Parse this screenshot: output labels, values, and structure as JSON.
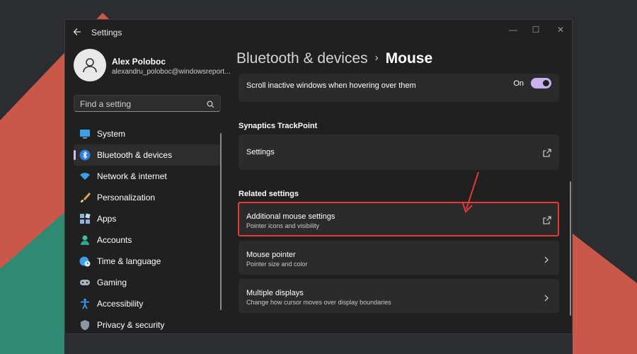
{
  "window": {
    "title": "Settings"
  },
  "account": {
    "name": "Alex Poloboc",
    "email": "alexandru_poloboc@windowsreport..."
  },
  "search": {
    "placeholder": "Find a setting"
  },
  "nav": [
    {
      "label": "System",
      "icon": "monitor-icon"
    },
    {
      "label": "Bluetooth & devices",
      "icon": "bluetooth-icon",
      "active": true
    },
    {
      "label": "Network & internet",
      "icon": "wifi-icon"
    },
    {
      "label": "Personalization",
      "icon": "brush-icon"
    },
    {
      "label": "Apps",
      "icon": "apps-icon"
    },
    {
      "label": "Accounts",
      "icon": "person-icon"
    },
    {
      "label": "Time & language",
      "icon": "globe-clock-icon"
    },
    {
      "label": "Gaming",
      "icon": "gamepad-icon"
    },
    {
      "label": "Accessibility",
      "icon": "accessibility-icon"
    },
    {
      "label": "Privacy & security",
      "icon": "shield-icon"
    }
  ],
  "breadcrumb": {
    "parent": "Bluetooth & devices",
    "separator": "›",
    "current": "Mouse"
  },
  "scroll_inactive": {
    "label": "Scroll inactive windows when hovering over them",
    "state": "On"
  },
  "trackpoint": {
    "heading": "Synaptics TrackPoint",
    "settings_label": "Settings"
  },
  "related": {
    "heading": "Related settings",
    "items": [
      {
        "title": "Additional mouse settings",
        "subtitle": "Pointer icons and visibility",
        "icon": "open-external-icon"
      },
      {
        "title": "Mouse pointer",
        "subtitle": "Pointer size and color",
        "icon": "chevron-right-icon"
      },
      {
        "title": "Multiple displays",
        "subtitle": "Change how cursor moves over display boundaries",
        "icon": "chevron-right-icon"
      }
    ]
  },
  "colors": {
    "accent": "#cbb0ee",
    "highlight": "#e53935"
  }
}
